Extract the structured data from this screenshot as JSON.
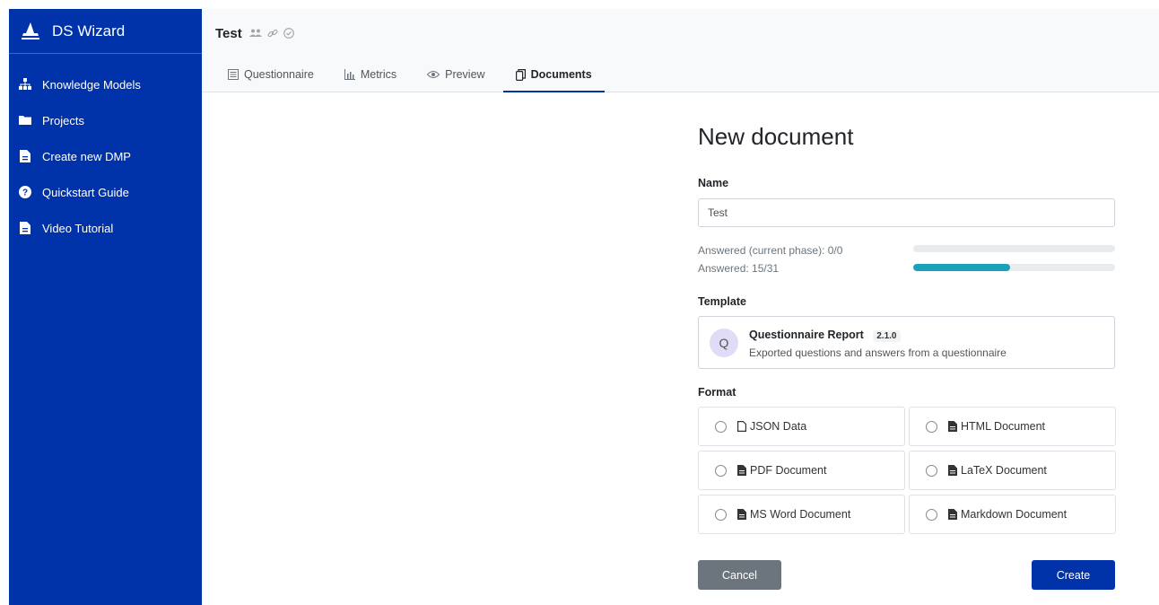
{
  "app": {
    "name": "DS Wizard"
  },
  "sidebar": {
    "items": [
      {
        "label": "Knowledge Models",
        "icon": "sitemap-icon"
      },
      {
        "label": "Projects",
        "icon": "folder-icon"
      },
      {
        "label": "Create new DMP",
        "icon": "file-icon"
      },
      {
        "label": "Quickstart Guide",
        "icon": "question-circle-icon"
      },
      {
        "label": "Video Tutorial",
        "icon": "file-icon"
      }
    ]
  },
  "project": {
    "title": "Test"
  },
  "tabs": [
    {
      "label": "Questionnaire",
      "icon": "list-icon"
    },
    {
      "label": "Metrics",
      "icon": "chart-icon"
    },
    {
      "label": "Preview",
      "icon": "eye-icon"
    },
    {
      "label": "Documents",
      "icon": "copy-icon",
      "active": true
    }
  ],
  "form": {
    "title": "New document",
    "name_label": "Name",
    "name_value": "Test",
    "progress": [
      {
        "label": "Answered (current phase): 0/0",
        "fraction": 0
      },
      {
        "label": "Answered: 15/31",
        "fraction": 0.48
      }
    ],
    "template_label": "Template",
    "template": {
      "avatar": "Q",
      "name": "Questionnaire Report",
      "version": "2.1.0",
      "description": "Exported questions and answers from a questionnaire"
    },
    "format_label": "Format",
    "formats": [
      "JSON Data",
      "HTML Document",
      "PDF Document",
      "LaTeX Document",
      "MS Word Document",
      "Markdown Document"
    ],
    "cancel_label": "Cancel",
    "create_label": "Create"
  },
  "colors": {
    "sidebar": "#0033aa",
    "accent": "#0033aa",
    "progress": "#17a2b8",
    "cancel": "#6c757d"
  }
}
